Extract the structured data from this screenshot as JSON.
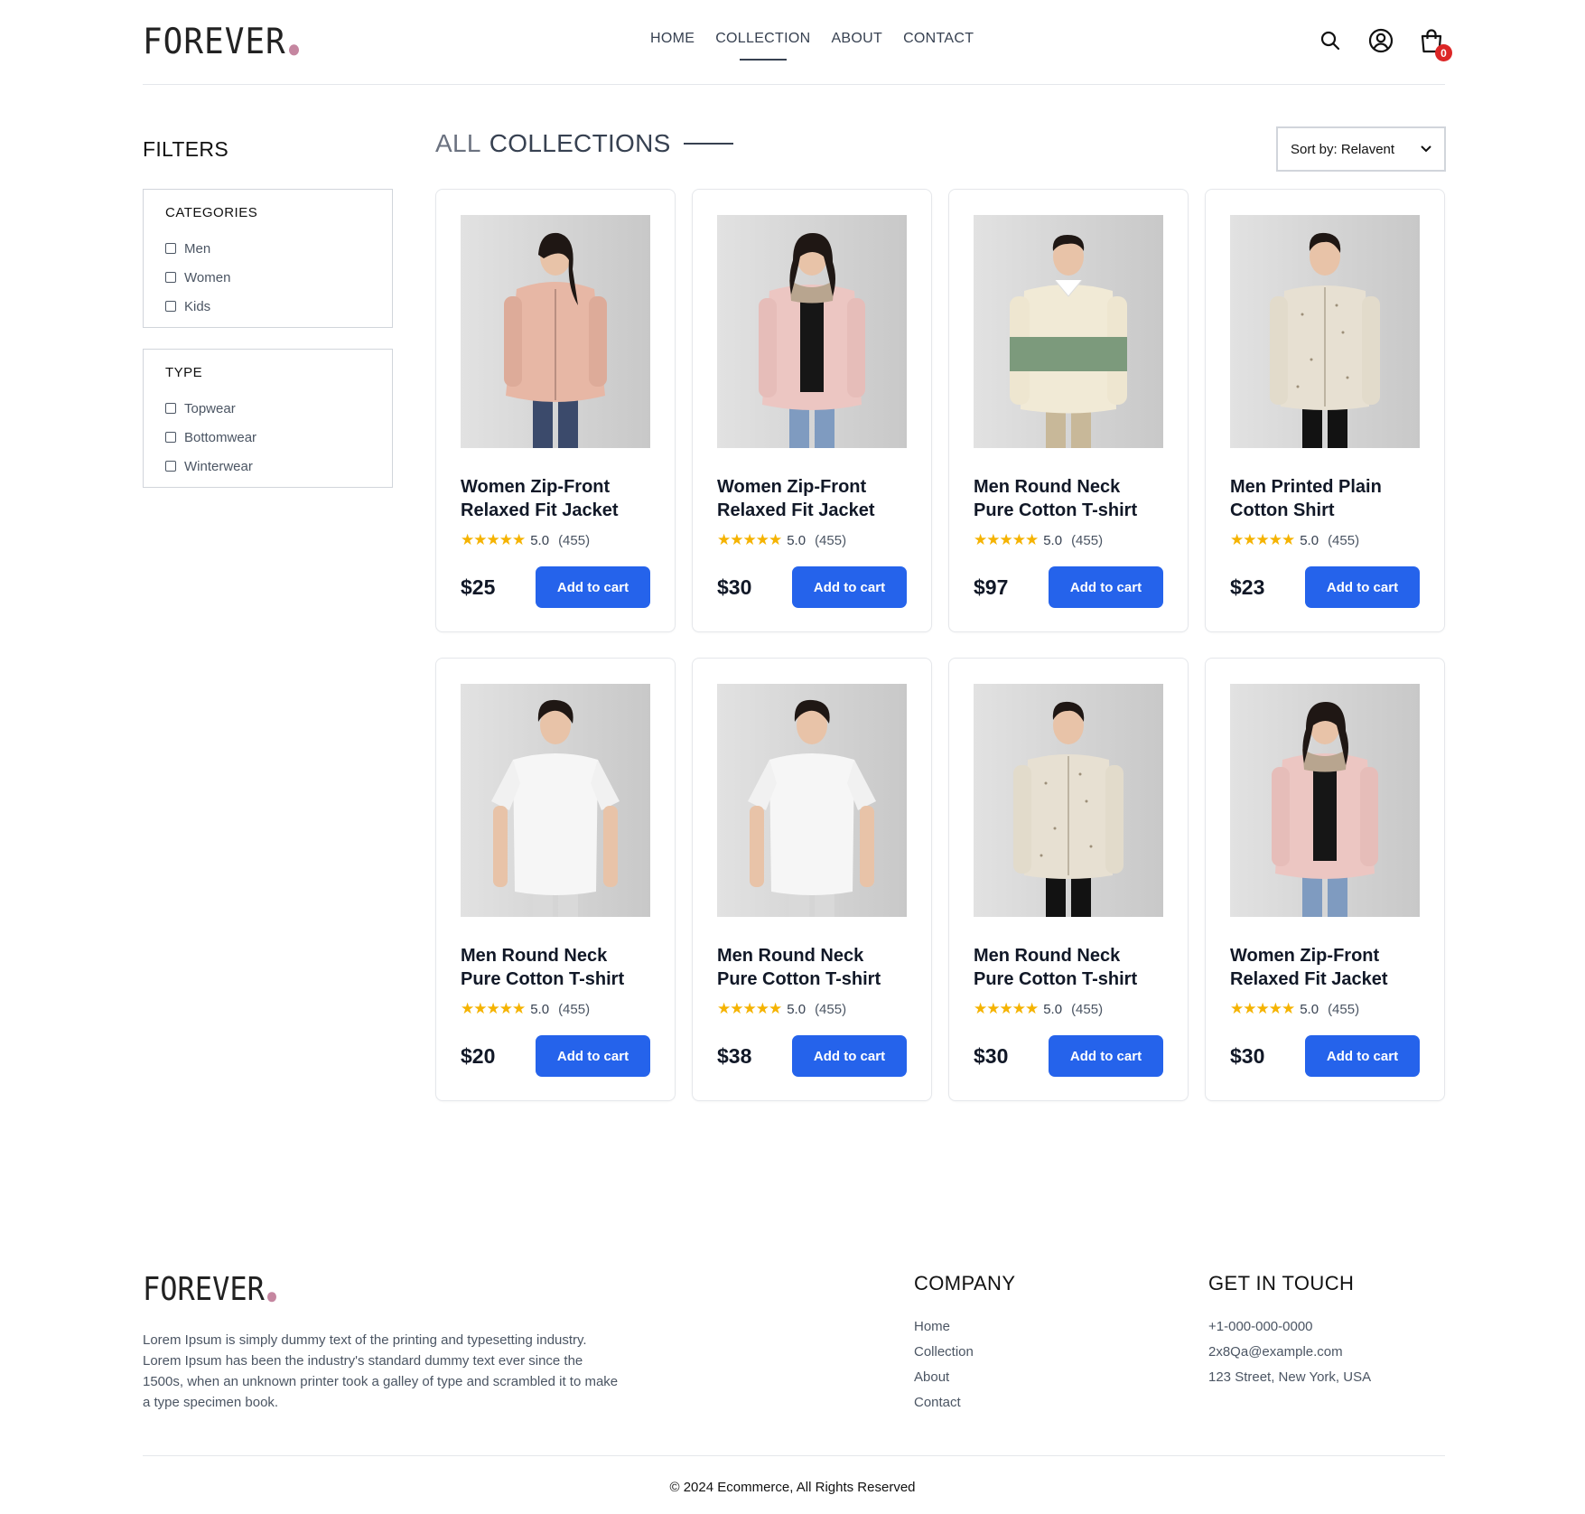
{
  "brand": {
    "name": "FOREVER",
    "dot_color": "#c586a0"
  },
  "nav": {
    "items": [
      {
        "label": "HOME"
      },
      {
        "label": "COLLECTION",
        "active": true
      },
      {
        "label": "ABOUT"
      },
      {
        "label": "CONTACT"
      }
    ]
  },
  "header_icons": {
    "search": "search-icon",
    "profile": "user-icon",
    "cart": "shopping-bag-icon",
    "cart_count": "0"
  },
  "filters": {
    "title": "FILTERS",
    "categories": {
      "heading": "CATEGORIES",
      "options": [
        "Men",
        "Women",
        "Kids"
      ]
    },
    "type": {
      "heading": "TYPE",
      "options": [
        "Topwear",
        "Bottomwear",
        "Winterwear"
      ]
    }
  },
  "collection": {
    "title_light": "ALL",
    "title_dark": "COLLECTIONS",
    "sort_label": "Sort by: Relavent"
  },
  "products": [
    {
      "name": "Women Zip-Front Relaxed Fit Jacket",
      "rating": "5.0",
      "reviews": "(455)",
      "price": "$25",
      "cta": "Add to cart",
      "image": "women-pink-bomber-jacket"
    },
    {
      "name": "Women Zip-Front Relaxed Fit Jacket",
      "rating": "5.0",
      "reviews": "(455)",
      "price": "$30",
      "cta": "Add to cart",
      "image": "women-pink-puffer-jacket"
    },
    {
      "name": "Men Round Neck Pure Cotton T-shirt",
      "rating": "5.0",
      "reviews": "(455)",
      "price": "$97",
      "cta": "Add to cart",
      "image": "men-striped-sweatshirt"
    },
    {
      "name": "Men Printed Plain Cotton Shirt",
      "rating": "5.0",
      "reviews": "(455)",
      "price": "$23",
      "cta": "Add to cart",
      "image": "men-printed-shirt"
    },
    {
      "name": "Men Round Neck Pure Cotton T-shirt",
      "rating": "5.0",
      "reviews": "(455)",
      "price": "$20",
      "cta": "Add to cart",
      "image": "men-white-tshirt"
    },
    {
      "name": "Men Round Neck Pure Cotton T-shirt",
      "rating": "5.0",
      "reviews": "(455)",
      "price": "$38",
      "cta": "Add to cart",
      "image": "men-white-tshirt"
    },
    {
      "name": "Men Round Neck Pure Cotton T-shirt",
      "rating": "5.0",
      "reviews": "(455)",
      "price": "$30",
      "cta": "Add to cart",
      "image": "men-printed-shirt"
    },
    {
      "name": "Women Zip-Front Relaxed Fit Jacket",
      "rating": "5.0",
      "reviews": "(455)",
      "price": "$30",
      "cta": "Add to cart",
      "image": "women-pink-puffer-jacket"
    }
  ],
  "footer": {
    "description": "Lorem Ipsum is simply dummy text of the printing and typesetting industry. Lorem Ipsum has been the industry's standard dummy text ever since the 1500s, when an unknown printer took a galley of type and scrambled it to make a type specimen book.",
    "company": {
      "heading": "COMPANY",
      "links": [
        "Home",
        "Collection",
        "About",
        "Contact"
      ]
    },
    "contact": {
      "heading": "GET IN TOUCH",
      "items": [
        "+1-000-000-0000",
        "2x8Qa@example.com",
        "123 Street, New York, USA"
      ]
    },
    "copyright": "© 2024 Ecommerce, All Rights Reserved"
  },
  "colors": {
    "accent": "#2563eb",
    "star": "#f5b301",
    "badge": "#dc2626"
  }
}
